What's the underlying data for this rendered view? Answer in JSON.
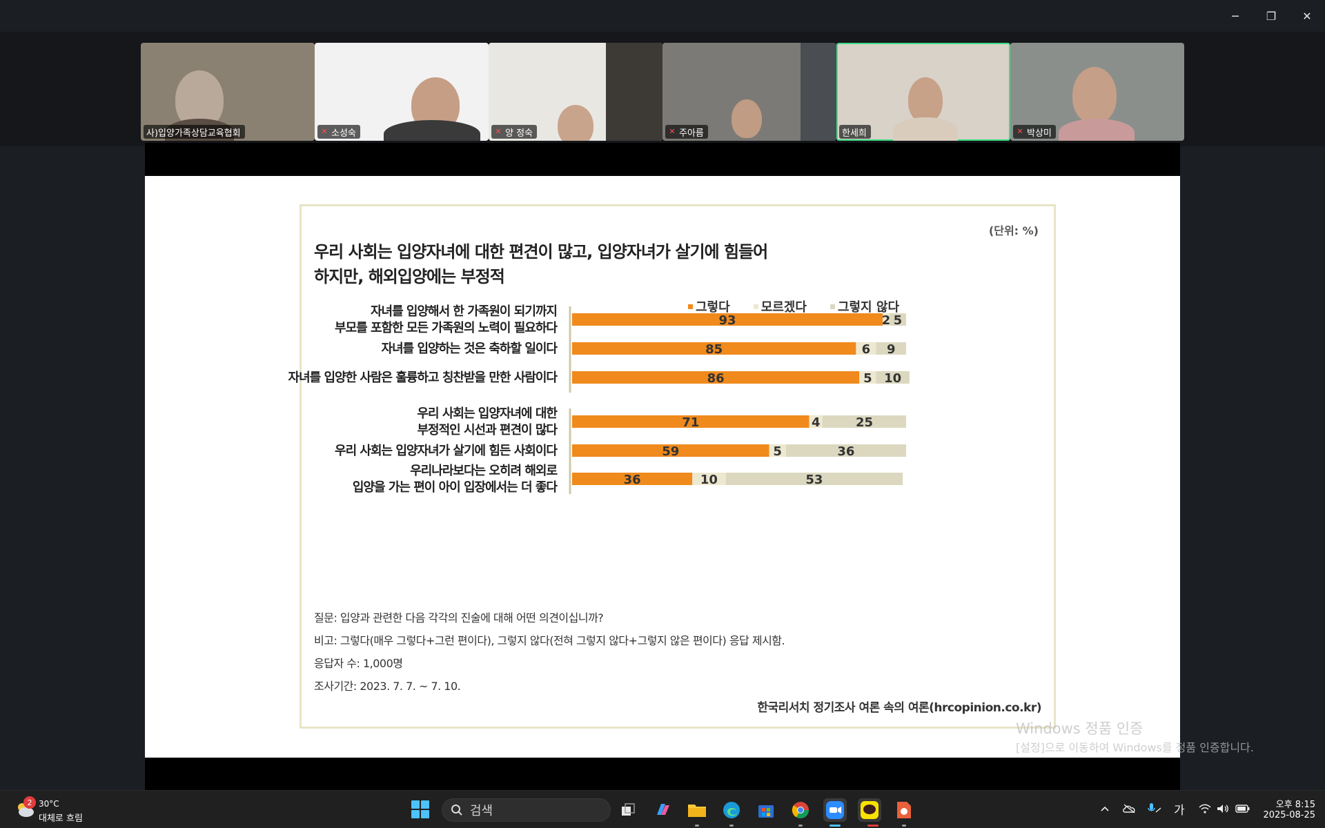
{
  "window": {
    "min_icon": "─",
    "max_icon": "❐",
    "close_icon": "✕"
  },
  "participants": [
    {
      "name": "사)입양가족상담교육협회",
      "muted": false,
      "bg": "#8b8172"
    },
    {
      "name": "소성숙",
      "muted": true,
      "bg": "#f2f2f2"
    },
    {
      "name": "양 정숙",
      "muted": true,
      "bg": "#e9e7e2"
    },
    {
      "name": "주아름",
      "muted": true,
      "bg": "#7c7a76"
    },
    {
      "name": "한세희",
      "muted": false,
      "bg": "#d8d2c8",
      "active": true
    },
    {
      "name": "박상미",
      "muted": true,
      "bg": "#8a8f8c"
    }
  ],
  "slide": {
    "unit": "(단위: %)",
    "title_line1": "우리 사회는 입양자녀에 대한 편견이 많고, 입양자녀가 살기에 힘들어",
    "title_line2": "하지만, 해외입양에는 부정적",
    "legend": [
      {
        "label": "그렇다",
        "color": "#f08a1c"
      },
      {
        "label": "모르겠다",
        "color": "#ede8d0"
      },
      {
        "label": "그렇지 않다",
        "color": "#dcd8c0"
      }
    ],
    "notes": {
      "question": "질문: 입양과 관련한 다음 각각의 진술에 대해 어떤 의견이십니까?",
      "remark": "비고: 그렇다(매우 그렇다+그런 편이다), 그렇지 않다(전혀 그렇지 않다+그렇지 않은 편이다) 응답 제시함.",
      "respondents": "응답자 수: 1,000명",
      "period": "조사기간: 2023. 7. 7. ~ 7. 10."
    },
    "source": "한국리서치 정기조사 여론 속의 여론(hrcopinion.co.kr)"
  },
  "chart_data": {
    "type": "bar",
    "orientation": "horizontal",
    "stacked": true,
    "xlim": [
      0,
      100
    ],
    "categories": [
      [
        "자녀를 입양해서 한 가족원이 되기까지",
        "부모를 포함한 모든 가족원의 노력이 필요하다"
      ],
      [
        "자녀를 입양하는 것은 축하할 일이다"
      ],
      [
        "자녀를 입양한 사람은 훌륭하고 칭찬받을 만한 사람이다"
      ],
      [
        "우리 사회는 입양자녀에 대한",
        "부정적인 시선과 편견이 많다"
      ],
      [
        "우리 사회는 입양자녀가 살기에 힘든 사회이다"
      ],
      [
        "우리나라보다는 오히려 해외로",
        "입양을 가는 편이 아이 입장에서는 더 좋다"
      ]
    ],
    "series": [
      {
        "name": "그렇다",
        "values": [
          93,
          85,
          86,
          71,
          59,
          36
        ]
      },
      {
        "name": "모르겠다",
        "values": [
          2,
          6,
          5,
          4,
          5,
          10
        ]
      },
      {
        "name": "그렇지 않다",
        "values": [
          5,
          9,
          10,
          25,
          36,
          53
        ]
      }
    ]
  },
  "watermark": {
    "title": "Windows 정품 인증",
    "subtitle": "[설정]으로 이동하여 Windows를 정품 인증합니다."
  },
  "taskbar": {
    "weather_badge": "2",
    "weather_temp": "30°C",
    "weather_desc": "대체로 흐림",
    "search_placeholder": "검색",
    "ime": "가",
    "time": "오후 8:15",
    "date": "2025-08-25"
  }
}
